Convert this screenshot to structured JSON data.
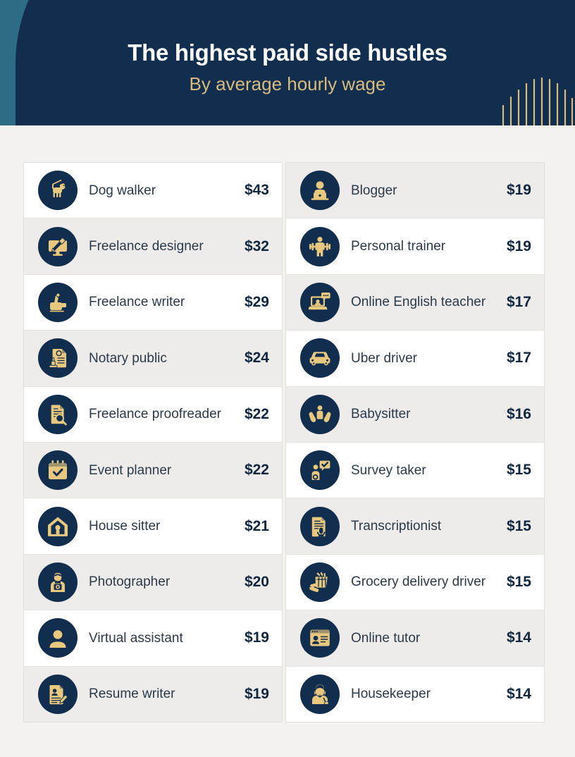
{
  "header": {
    "title": "The highest paid side hustles",
    "subtitle": "By average hourly wage",
    "bg_teal": "#2e6b85",
    "bg_navy": "#112e4e",
    "title_color": "#ffffff",
    "subtitle_color": "#d8bb7d",
    "accent_gold": "#e8c87e"
  },
  "page": {
    "background": "#f4f2ee"
  },
  "chart_data": {
    "type": "table",
    "title": "The highest paid side hustles",
    "subtitle": "By average hourly wage",
    "columns": [
      "Side hustle",
      "Average hourly wage"
    ],
    "categories": [
      "Dog walker",
      "Freelance designer",
      "Freelance writer",
      "Notary public",
      "Freelance proofreader",
      "Event planner",
      "House sitter",
      "Photographer",
      "Virtual assistant",
      "Resume writer",
      "Blogger",
      "Personal trainer",
      "Online English teacher",
      "Uber driver",
      "Babysitter",
      "Survey taker",
      "Transcriptionist",
      "Grocery delivery driver",
      "Online tutor",
      "Housekeeper"
    ],
    "values": [
      43,
      32,
      29,
      24,
      22,
      22,
      21,
      20,
      19,
      19,
      19,
      19,
      17,
      17,
      16,
      15,
      15,
      15,
      14,
      14
    ],
    "unit": "USD per hour",
    "value_prefix": "$"
  },
  "left_column": [
    {
      "label": "Dog walker",
      "price": "$43",
      "icon": "dog-icon",
      "shade": "plain"
    },
    {
      "label": "Freelance designer",
      "price": "$32",
      "icon": "design-icon",
      "shade": "alt"
    },
    {
      "label": "Freelance writer",
      "price": "$29",
      "icon": "writing-hand-icon",
      "shade": "plain"
    },
    {
      "label": "Notary public",
      "price": "$24",
      "icon": "notary-stamp-icon",
      "shade": "alt"
    },
    {
      "label": "Freelance proofreader",
      "price": "$22",
      "icon": "proofread-icon",
      "shade": "plain"
    },
    {
      "label": "Event planner",
      "price": "$22",
      "icon": "calendar-icon",
      "shade": "alt"
    },
    {
      "label": "House sitter",
      "price": "$21",
      "icon": "house-icon",
      "shade": "plain"
    },
    {
      "label": "Photographer",
      "price": "$20",
      "icon": "photographer-icon",
      "shade": "alt"
    },
    {
      "label": "Virtual assistant",
      "price": "$19",
      "icon": "headset-icon",
      "shade": "plain"
    },
    {
      "label": "Resume writer",
      "price": "$19",
      "icon": "resume-icon",
      "shade": "alt"
    }
  ],
  "right_column": [
    {
      "label": "Blogger",
      "price": "$19",
      "icon": "blogger-icon",
      "shade": "alt"
    },
    {
      "label": "Personal trainer",
      "price": "$19",
      "icon": "barbell-icon",
      "shade": "plain"
    },
    {
      "label": "Online English teacher",
      "price": "$17",
      "icon": "laptop-chat-icon",
      "shade": "alt"
    },
    {
      "label": "Uber driver",
      "price": "$17",
      "icon": "car-icon",
      "shade": "plain"
    },
    {
      "label": "Babysitter",
      "price": "$16",
      "icon": "baby-hands-icon",
      "shade": "alt"
    },
    {
      "label": "Survey taker",
      "price": "$15",
      "icon": "survey-icon",
      "shade": "plain"
    },
    {
      "label": "Transcriptionist",
      "price": "$15",
      "icon": "mic-document-icon",
      "shade": "alt"
    },
    {
      "label": "Grocery delivery driver",
      "price": "$15",
      "icon": "grocery-bag-icon",
      "shade": "plain"
    },
    {
      "label": "Online tutor",
      "price": "$14",
      "icon": "browser-tutor-icon",
      "shade": "alt"
    },
    {
      "label": "Housekeeper",
      "price": "$14",
      "icon": "housekeeper-icon",
      "shade": "plain"
    }
  ]
}
